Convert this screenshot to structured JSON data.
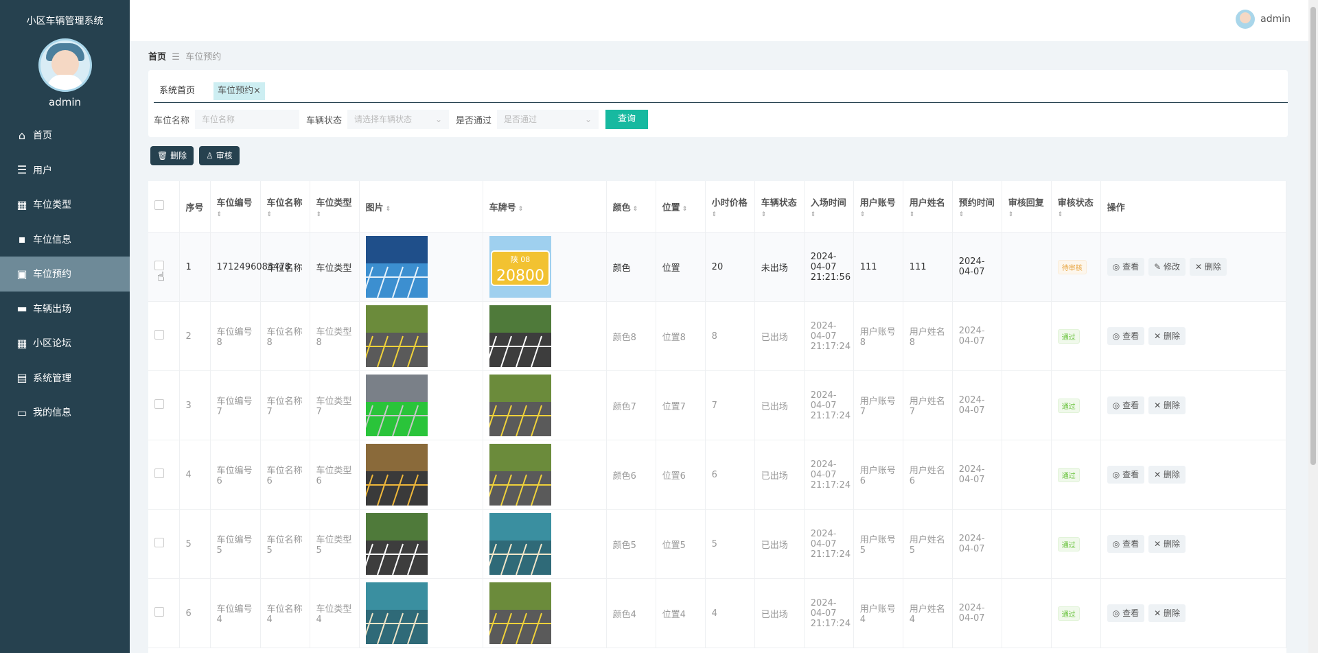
{
  "app": {
    "title": "小区车辆管理系统",
    "username": "admin"
  },
  "sidebar": {
    "items": [
      {
        "label": "首页",
        "icon": "home-icon"
      },
      {
        "label": "用户",
        "icon": "sliders-icon"
      },
      {
        "label": "车位类型",
        "icon": "grid-icon"
      },
      {
        "label": "车位信息",
        "icon": "chat-icon"
      },
      {
        "label": "车位预约",
        "icon": "calendar-icon"
      },
      {
        "label": "车辆出场",
        "icon": "monitor-icon"
      },
      {
        "label": "小区论坛",
        "icon": "grid-icon"
      },
      {
        "label": "系统管理",
        "icon": "clipboard-icon"
      },
      {
        "label": "我的信息",
        "icon": "card-icon"
      }
    ]
  },
  "topbar": {
    "username": "admin"
  },
  "breadcrumb": {
    "home": "首页",
    "separator": "☰",
    "current": "车位预约"
  },
  "tabs": [
    {
      "label": "系统首页"
    },
    {
      "label": "车位预约"
    }
  ],
  "tab_close": "×",
  "search": {
    "name_label": "车位名称",
    "name_placeholder": "车位名称",
    "status_label": "车辆状态",
    "status_placeholder": "请选择车辆状态",
    "pass_label": "是否通过",
    "pass_placeholder": "是否通过",
    "query_button": "查询"
  },
  "toolbar": {
    "delete_label": "删除",
    "audit_label": "审核"
  },
  "table": {
    "headers": [
      "序号",
      "车位编号",
      "车位名称",
      "车位类型",
      "图片",
      "车牌号",
      "颜色",
      "位置",
      "小时价格",
      "车辆状态",
      "入场时间",
      "用户账号",
      "用户姓名",
      "预约时间",
      "审核回复",
      "审核状态",
      "操作"
    ],
    "action_labels": {
      "view": "查看",
      "edit": "修改",
      "delete": "删除"
    },
    "rows": [
      {
        "index": "1",
        "code": "1712496083478",
        "name": "车位名称",
        "type": "车位类型",
        "color": "颜色",
        "location": "位置",
        "price": "20",
        "status": "未出场",
        "entry_time": "2024-04-07 21:21:56",
        "account": "111",
        "username": "111",
        "reserve_time": "2024-04-07",
        "reply": "",
        "audit": "待审核"
      },
      {
        "index": "2",
        "code": "车位编号8",
        "name": "车位名称8",
        "type": "车位类型8",
        "color": "颜色8",
        "location": "位置8",
        "price": "8",
        "status": "已出场",
        "entry_time": "2024-04-07 21:17:24",
        "account": "用户账号8",
        "username": "用户姓名8",
        "reserve_time": "2024-04-07",
        "reply": "",
        "audit": "通过"
      },
      {
        "index": "3",
        "code": "车位编号7",
        "name": "车位名称7",
        "type": "车位类型7",
        "color": "颜色7",
        "location": "位置7",
        "price": "7",
        "status": "已出场",
        "entry_time": "2024-04-07 21:17:24",
        "account": "用户账号7",
        "username": "用户姓名7",
        "reserve_time": "2024-04-07",
        "reply": "",
        "audit": "通过"
      },
      {
        "index": "4",
        "code": "车位编号6",
        "name": "车位名称6",
        "type": "车位类型6",
        "color": "颜色6",
        "location": "位置6",
        "price": "6",
        "status": "已出场",
        "entry_time": "2024-04-07 21:17:24",
        "account": "用户账号6",
        "username": "用户姓名6",
        "reserve_time": "2024-04-07",
        "reply": "",
        "audit": "通过"
      },
      {
        "index": "5",
        "code": "车位编号5",
        "name": "车位名称5",
        "type": "车位类型5",
        "color": "颜色5",
        "location": "位置5",
        "price": "5",
        "status": "已出场",
        "entry_time": "2024-04-07 21:17:24",
        "account": "用户账号5",
        "username": "用户姓名5",
        "reserve_time": "2024-04-07",
        "reply": "",
        "audit": "通过"
      },
      {
        "index": "6",
        "code": "车位编号4",
        "name": "车位名称4",
        "type": "车位类型4",
        "color": "颜色4",
        "location": "位置4",
        "price": "4",
        "status": "已出场",
        "entry_time": "2024-04-07 21:17:24",
        "account": "用户账号4",
        "username": "用户姓名4",
        "reserve_time": "2024-04-07",
        "reply": "",
        "audit": "通过"
      }
    ]
  },
  "plate_text": {
    "top": "陕 08",
    "bottom": "20800"
  },
  "colors": {
    "sidebar_bg": "#26414f",
    "active_item": "#6e8a98",
    "primary": "#17b9a0",
    "pass": "#67c23a",
    "pending": "#e6a23c"
  }
}
